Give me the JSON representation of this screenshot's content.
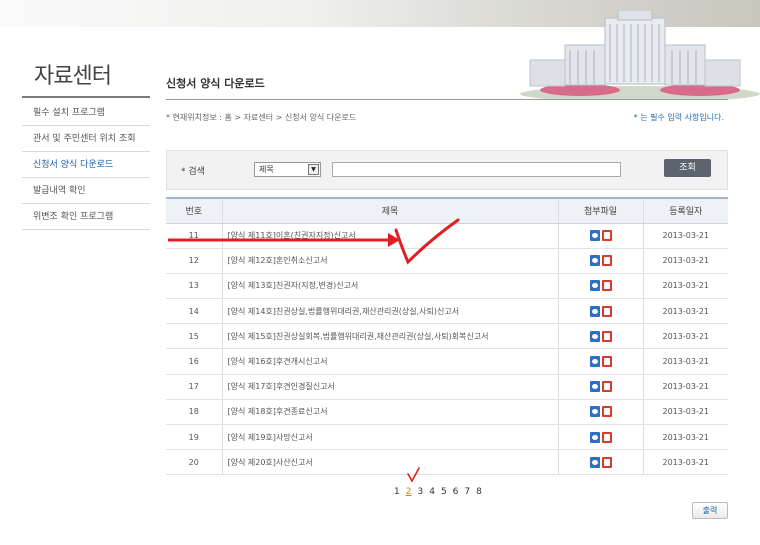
{
  "sidebar": {
    "title": "자료센터",
    "items": [
      {
        "label": "필수 설치 프로그램"
      },
      {
        "label": "관서 및 주민센터 위치 조회"
      },
      {
        "label": "신청서 양식 다운로드"
      },
      {
        "label": "발급내역 확인"
      },
      {
        "label": "위변조 확인 프로그램"
      }
    ]
  },
  "header": {
    "page_title": "신청서 양식 다운로드",
    "location": "* 현재위치정보 : 홈 > 자료센터 > 신청서 양식 다운로드",
    "required_note": "* 는 필수 입력 사항입니다."
  },
  "search": {
    "label": "* 검색",
    "select_value": "제목",
    "input_value": "",
    "button_label": "조회"
  },
  "table": {
    "headers": [
      "번호",
      "제목",
      "첨부파일",
      "등록일자"
    ],
    "rows": [
      {
        "no": "11",
        "title": "[양식 제11호]이혼(친권자지정)신고서",
        "date": "2013-03-21"
      },
      {
        "no": "12",
        "title": "[양식 제12호]혼인취소신고서",
        "date": "2013-03-21"
      },
      {
        "no": "13",
        "title": "[양식 제13호]친권자(지정,변경)신고서",
        "date": "2013-03-21"
      },
      {
        "no": "14",
        "title": "[양식 제14호]친권상실,법률행위대리권,재산관리권(상실,사퇴)신고서",
        "date": "2013-03-21"
      },
      {
        "no": "15",
        "title": "[양식 제15호]친권상실회복,법률행위대리권,재산관리권(상실,사퇴)회복신고서",
        "date": "2013-03-21"
      },
      {
        "no": "16",
        "title": "[양식 제16호]후견개시신고서",
        "date": "2013-03-21"
      },
      {
        "no": "17",
        "title": "[양식 제17호]후견인경질신고서",
        "date": "2013-03-21"
      },
      {
        "no": "18",
        "title": "[양식 제18호]후견종료신고서",
        "date": "2013-03-21"
      },
      {
        "no": "19",
        "title": "[양식 제19호]사망신고서",
        "date": "2013-03-21"
      },
      {
        "no": "20",
        "title": "[양식 제20호]사산신고서",
        "date": "2013-03-21"
      }
    ]
  },
  "pagination": {
    "pages": [
      "1",
      "2",
      "3",
      "4",
      "5",
      "6",
      "7",
      "8"
    ],
    "current": "2"
  },
  "print_label": "출력",
  "colors": {
    "accent_blue": "#1e5fa8",
    "annotation_red": "#e02020"
  },
  "icons": {
    "attachment": [
      "hwp-file-icon",
      "pdf-file-icon"
    ]
  }
}
